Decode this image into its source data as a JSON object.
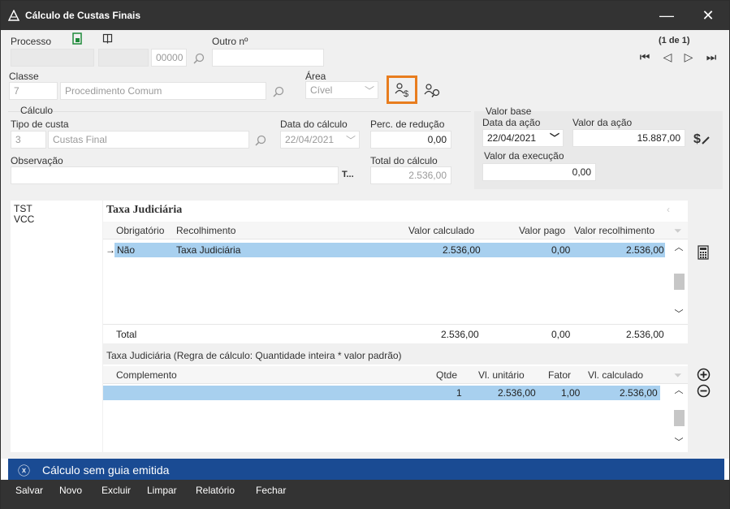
{
  "window": {
    "title": "Cálculo de Custas Finais",
    "minimize": "—",
    "close": "✕"
  },
  "processo": {
    "label": "Processo",
    "field4": "00000",
    "outro_label": "Outro nº",
    "outro_value": ""
  },
  "nav": {
    "counter": "(1 de 1)"
  },
  "classe": {
    "label": "Classe",
    "code": "7",
    "name": "Procedimento Comum"
  },
  "area": {
    "label": "Área",
    "value": "Cível"
  },
  "calculo": {
    "section": "Cálculo",
    "tipo_label": "Tipo de custa",
    "tipo_code": "3",
    "tipo_name": "Custas Final",
    "data_label": "Data do cálculo",
    "data_value": "22/04/2021",
    "perc_label": "Perc. de redução",
    "perc_value": "0,00",
    "obs_label": "Observação",
    "obs_value": "",
    "obs_btn": "T...",
    "total_label": "Total do cálculo",
    "total_value": "2.536,00"
  },
  "valor_base": {
    "section": "Valor base",
    "data_acao_label": "Data da ação",
    "data_acao_value": "22/04/2021",
    "valor_acao_label": "Valor da ação",
    "valor_acao_value": "15.887,00",
    "execucao_label": "Valor da execução",
    "execucao_value": "0,00"
  },
  "left_list": [
    "TST",
    "VCC"
  ],
  "taxa": {
    "title": "Taxa Judiciária",
    "headers": [
      "Obrigatório",
      "Recolhimento",
      "Valor calculado",
      "Valor pago",
      "Valor recolhimento"
    ],
    "row": {
      "marker": "→",
      "obrig": "Não",
      "recolhimento": "Taxa Judiciária",
      "calculado": "2.536,00",
      "pago": "0,00",
      "recolh": "2.536,00"
    },
    "total": {
      "label": "Total",
      "calculado": "2.536,00",
      "pago": "0,00",
      "recolh": "2.536,00"
    }
  },
  "regra": {
    "title": "Taxa Judiciária (Regra de cálculo: Quantidade inteira * valor padrão)",
    "headers": [
      "Complemento",
      "Qtde",
      "Vl. unitário",
      "Fator",
      "Vl. calculado"
    ],
    "row": {
      "complemento": "",
      "qtde": "1",
      "unit": "2.536,00",
      "fator": "1,00",
      "calc": "2.536,00"
    }
  },
  "status": {
    "icon": "ⓧ",
    "text": "Cálculo sem guia emitida"
  },
  "toolbar": [
    "Salvar",
    "Novo",
    "Excluir",
    "Limpar",
    "Relatório",
    "Fechar"
  ],
  "colors": {
    "titlebar": "#333333",
    "status": "#1a4b93",
    "selection": "#a8d0ef",
    "highlight": "#e87d1e"
  }
}
